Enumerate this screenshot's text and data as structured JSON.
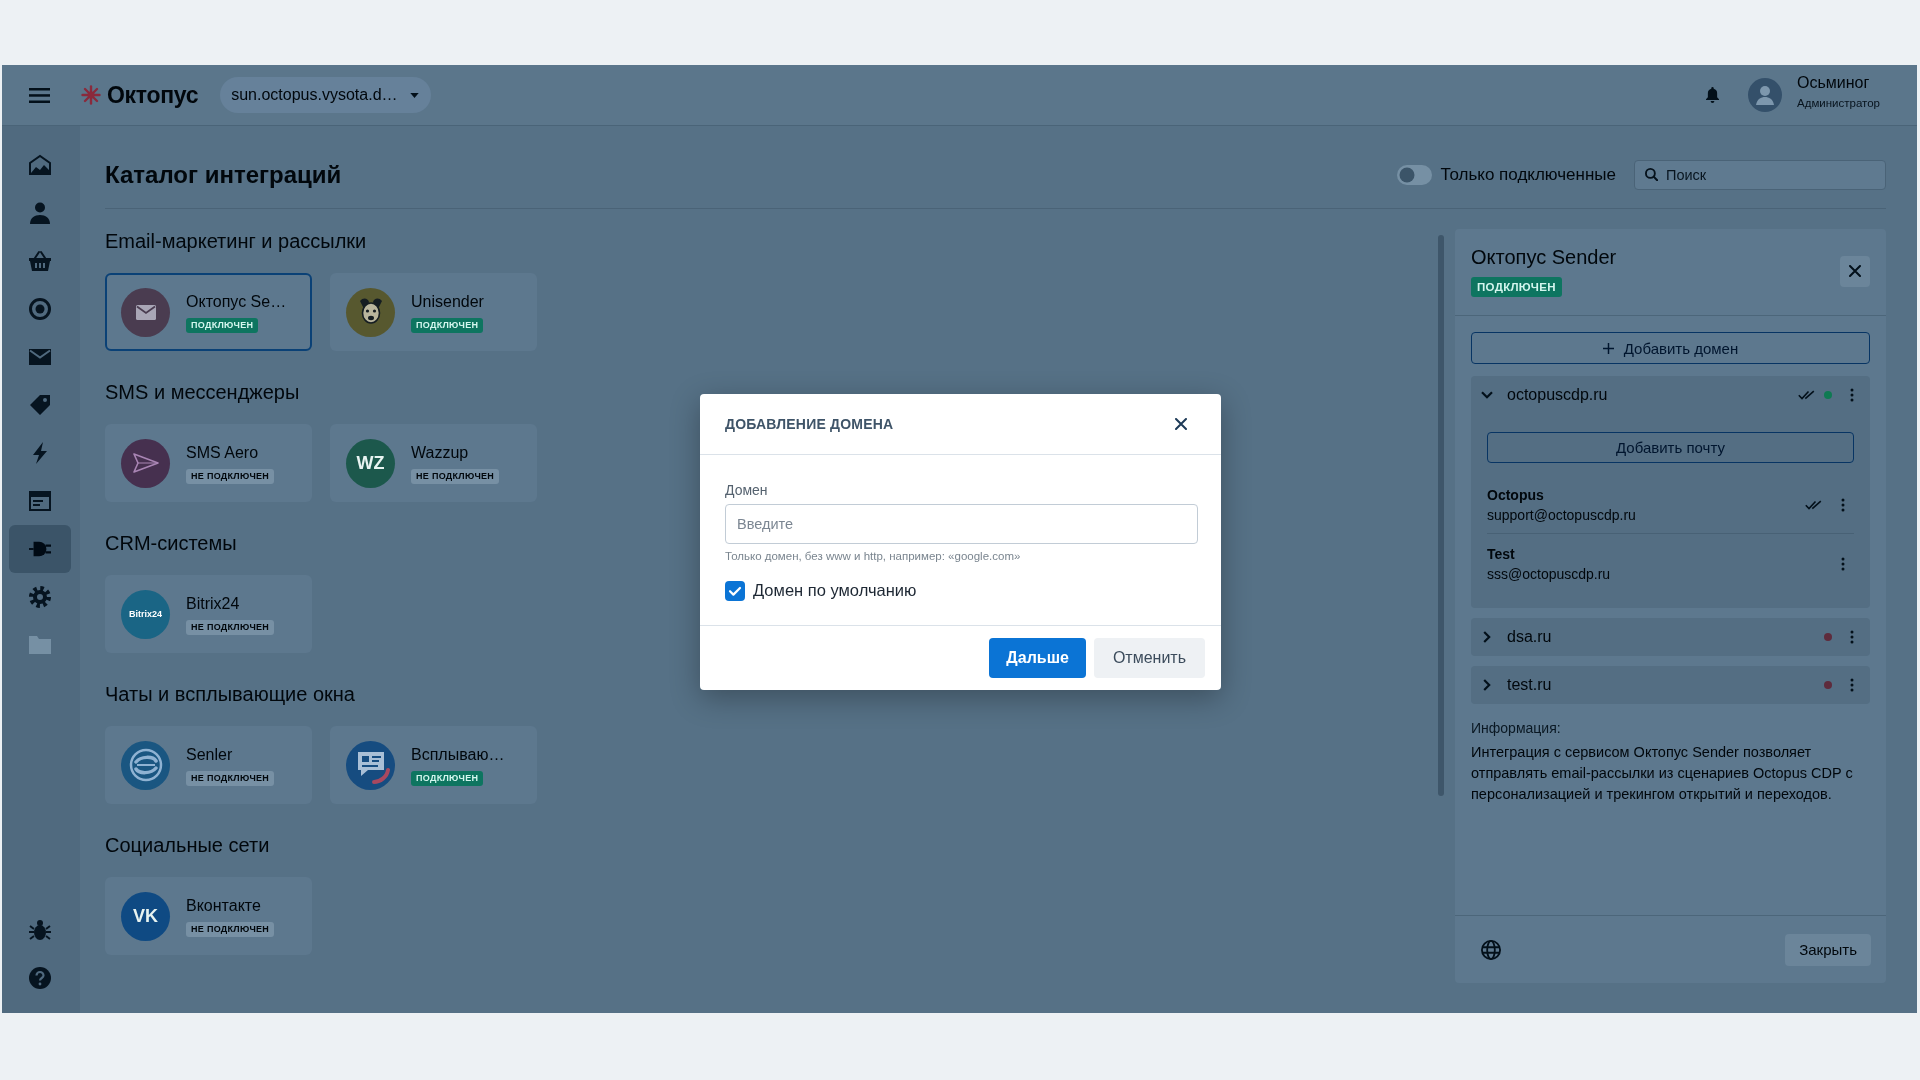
{
  "topbar": {
    "brand": "Октопус",
    "workspace": "sun.octopus.vysota.d…",
    "user": {
      "name": "Осьминог",
      "role": "Администратор"
    }
  },
  "sidebar": {
    "items": [
      {
        "selected": false,
        "disabled": false
      },
      {
        "selected": false,
        "disabled": false
      },
      {
        "selected": false,
        "disabled": false
      },
      {
        "selected": false,
        "disabled": false
      },
      {
        "selected": false,
        "disabled": false
      },
      {
        "selected": false,
        "disabled": false
      },
      {
        "selected": false,
        "disabled": false
      },
      {
        "selected": false,
        "disabled": false
      },
      {
        "selected": true,
        "disabled": false
      },
      {
        "selected": false,
        "disabled": false
      },
      {
        "selected": false,
        "disabled": true
      }
    ]
  },
  "header": {
    "title": "Каталог интеграций",
    "filter_toggle": {
      "label": "Только подключенные",
      "on": false
    },
    "search": {
      "placeholder": "Поиск"
    }
  },
  "catalog": {
    "sections": [
      {
        "title": "Email-маркетинг и рассылки",
        "cards": [
          {
            "name": "Октопус Se…",
            "status": "ПОДКЛЮЧЕН",
            "connected": true,
            "selected": true,
            "logo": {
              "kind": "envelope",
              "color": "#4a3c50"
            }
          },
          {
            "name": "Unisender",
            "status": "ПОДКЛЮЧЕН",
            "connected": true,
            "selected": false,
            "logo": {
              "kind": "dog",
              "color": "#57582f"
            }
          }
        ]
      },
      {
        "title": "SMS и мессенджеры",
        "cards": [
          {
            "name": "SMS Aero",
            "status": "НЕ ПОДКЛЮЧЕН",
            "connected": false,
            "selected": false,
            "logo": {
              "kind": "plane",
              "color": "#46304f"
            }
          },
          {
            "name": "Wazzup",
            "status": "НЕ ПОДКЛЮЧЕН",
            "connected": false,
            "selected": false,
            "logo": {
              "kind": "text",
              "text": "WZ",
              "color": "#1c584c"
            }
          }
        ]
      },
      {
        "title": "CRM-системы",
        "cards": [
          {
            "name": "Bitrix24",
            "status": "НЕ ПОДКЛЮЧЕН",
            "connected": false,
            "selected": false,
            "logo": {
              "kind": "text",
              "text": "Bitrix24",
              "color": "#1a6585"
            }
          }
        ]
      },
      {
        "title": "Чаты и всплывающие окна",
        "cards": [
          {
            "name": "Senler",
            "status": "НЕ ПОДКЛЮЧЕН",
            "connected": false,
            "selected": false,
            "logo": {
              "kind": "swirl",
              "color": "#1a5681"
            }
          },
          {
            "name": "Всплываю…",
            "status": "ПОДКЛЮЧЕН",
            "connected": true,
            "selected": false,
            "logo": {
              "kind": "chat",
              "color": "#164c80"
            }
          }
        ]
      },
      {
        "title": "Социальные сети",
        "cards": [
          {
            "name": "Вконтакте",
            "status": "НЕ ПОДКЛЮЧЕН",
            "connected": false,
            "selected": false,
            "logo": {
              "kind": "text",
              "text": "VK",
              "color": "#0f4a83"
            }
          }
        ]
      }
    ]
  },
  "panel": {
    "title": "Октопус Sender",
    "status": "ПОДКЛЮЧЕН",
    "connected": true,
    "add_domain": "Добавить домен",
    "domains": [
      {
        "name": "octopuscdp.ru",
        "expanded": true,
        "verified": true,
        "color": "#0f7a52",
        "add_email": "Добавить почту",
        "emails": [
          {
            "name": "Octopus",
            "address": "support@octopuscdp.ru",
            "verified": true
          },
          {
            "name": "Test",
            "address": "sss@octopuscdp.ru",
            "verified": false
          }
        ]
      },
      {
        "name": "dsa.ru",
        "expanded": false,
        "verified": false,
        "color": "#5e2b3c"
      },
      {
        "name": "test.ru",
        "expanded": false,
        "verified": false,
        "color": "#5e2b3c"
      }
    ],
    "info_label": "Информация:",
    "description": "Интеграция с сервисом Октопус Sender позволяет отправлять email-рассылки из сценариев Octopus CDP с персонализацией и трекингом открытий и переходов.",
    "close_label": "Закрыть"
  },
  "dialog": {
    "title": "ДОБАВЛЕНИЕ ДОМЕНА",
    "field": {
      "label": "Домен",
      "placeholder": "Введите",
      "hint": "Только домен, без www и http, например: «google.com»"
    },
    "checkbox": {
      "label": "Домен по умолчанию",
      "checked": true
    },
    "buttons": [
      {
        "label": "Дальше",
        "kind": "primary"
      },
      {
        "label": "Отменить",
        "kind": "secondary"
      }
    ]
  }
}
